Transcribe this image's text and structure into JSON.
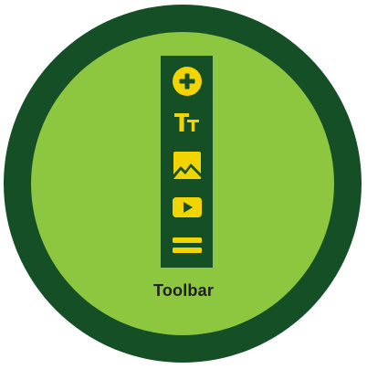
{
  "badge": {
    "label": "Toolbar",
    "colors": {
      "outer_ring": "#144f26",
      "inner_disc": "#8dc63f",
      "panel": "#144f26",
      "icon": "#f2d400",
      "label": "#1f1f1f"
    }
  },
  "toolbar": {
    "tools": [
      {
        "icon": "add-circle-icon"
      },
      {
        "icon": "text-size-icon"
      },
      {
        "icon": "image-icon"
      },
      {
        "icon": "video-icon"
      },
      {
        "icon": "divider-icon"
      }
    ]
  }
}
